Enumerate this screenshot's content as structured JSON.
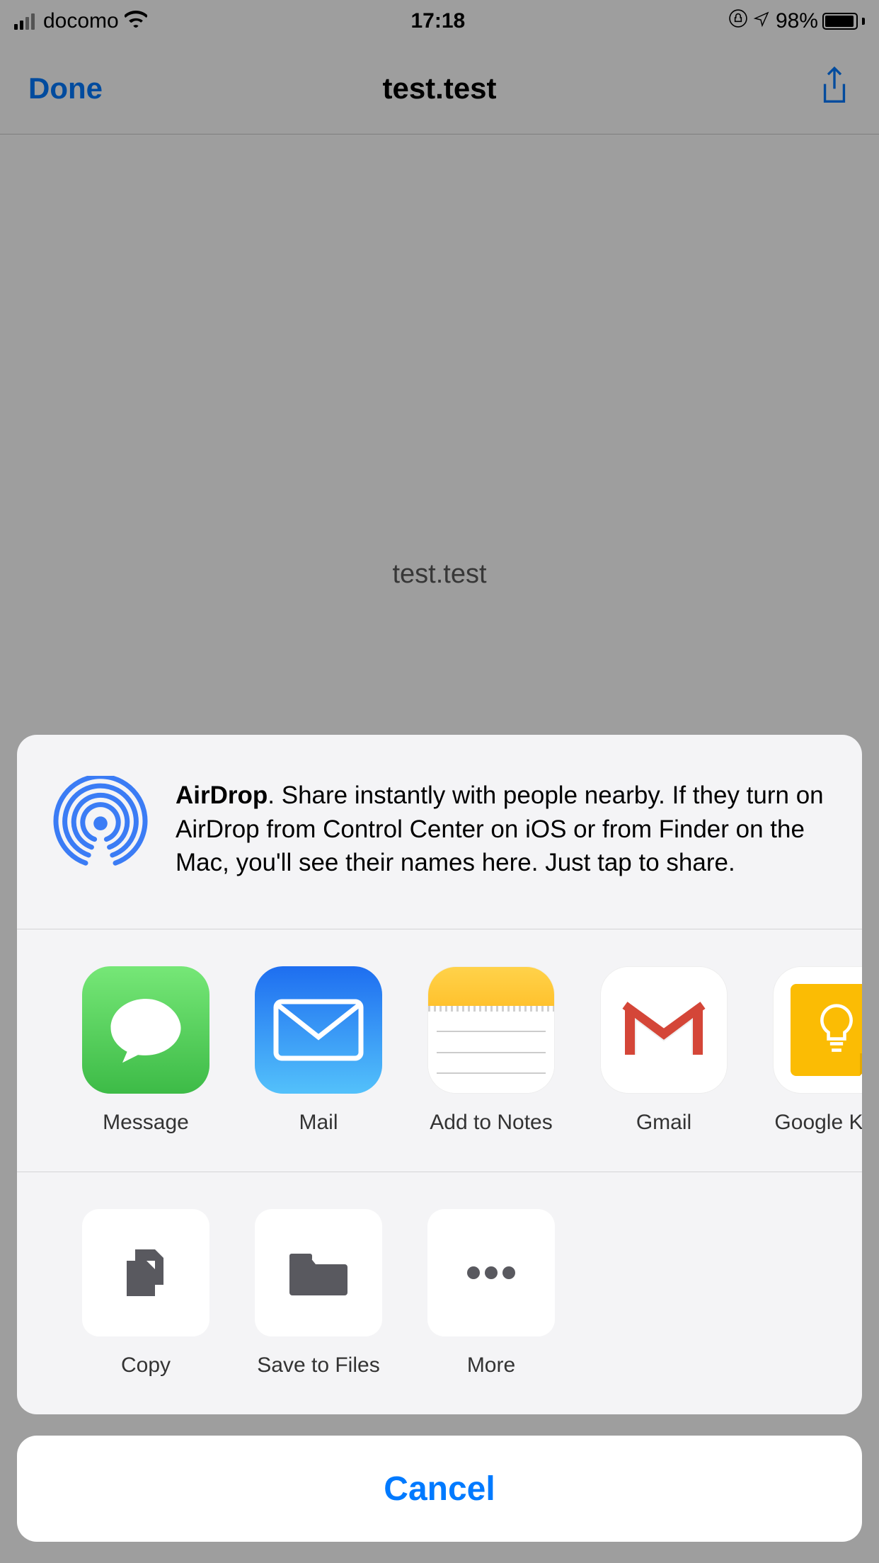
{
  "status_bar": {
    "carrier": "docomo",
    "time": "17:18",
    "battery_percent": "98%"
  },
  "nav": {
    "done_label": "Done",
    "title": "test.test"
  },
  "page": {
    "filename_display": "test.test"
  },
  "share_sheet": {
    "airdrop_title": "AirDrop",
    "airdrop_body": ". Share instantly with people nearby. If they turn on AirDrop from Control Center on iOS or from Finder on the Mac, you'll see their names here. Just tap to share.",
    "apps": [
      {
        "label": "Message",
        "icon": "message"
      },
      {
        "label": "Mail",
        "icon": "mail"
      },
      {
        "label": "Add to Notes",
        "icon": "notes"
      },
      {
        "label": "Gmail",
        "icon": "gmail"
      },
      {
        "label": "Google Keep",
        "icon": "keep"
      }
    ],
    "actions": [
      {
        "label": "Copy",
        "icon": "copy"
      },
      {
        "label": "Save to Files",
        "icon": "files"
      },
      {
        "label": "More",
        "icon": "more"
      }
    ],
    "cancel_label": "Cancel"
  }
}
